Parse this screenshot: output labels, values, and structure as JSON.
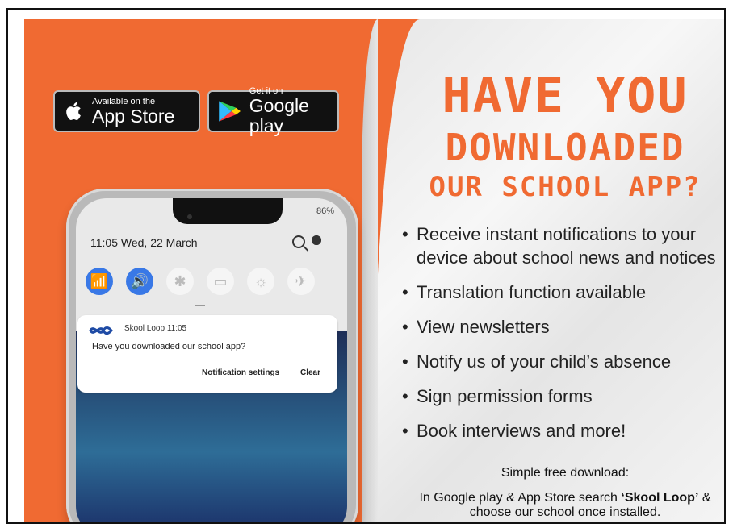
{
  "badges": {
    "apple": {
      "small": "Available on the",
      "big": "App Store"
    },
    "google": {
      "small": "Get it on",
      "big": "Google play"
    }
  },
  "headline": {
    "line1": "HAVE YOU",
    "line2": "DOWNLOADED",
    "line3": "OUR SCHOOL APP?"
  },
  "features": [
    "Receive instant notifications to your device about school news and notices",
    "Translation function available",
    "View newsletters",
    "Notify us of your child’s absence",
    "Sign permission forms",
    "Book interviews and more!"
  ],
  "simple_free": {
    "title": "Simple free download:",
    "desc_prefix": "In Google play & App Store search ",
    "desc_bold": "‘Skool Loop’",
    "desc_suffix": " & choose our school once installed."
  },
  "phone": {
    "status_right": "86%",
    "time": "11:05",
    "date": "Wed, 22 March",
    "quick_settings": [
      "wifi-icon",
      "speaker-icon",
      "bluetooth-icon",
      "battery-icon",
      "flashlight-icon",
      "airplane-icon"
    ],
    "notification": {
      "app": "Skool Loop",
      "app_time": "11:05",
      "message": "Have you downloaded our school app?",
      "btn_settings": "Notification settings",
      "btn_clear": "Clear"
    }
  },
  "colors": {
    "accent": "#f06a32",
    "text": "#222222",
    "badge_bg": "#111111"
  }
}
